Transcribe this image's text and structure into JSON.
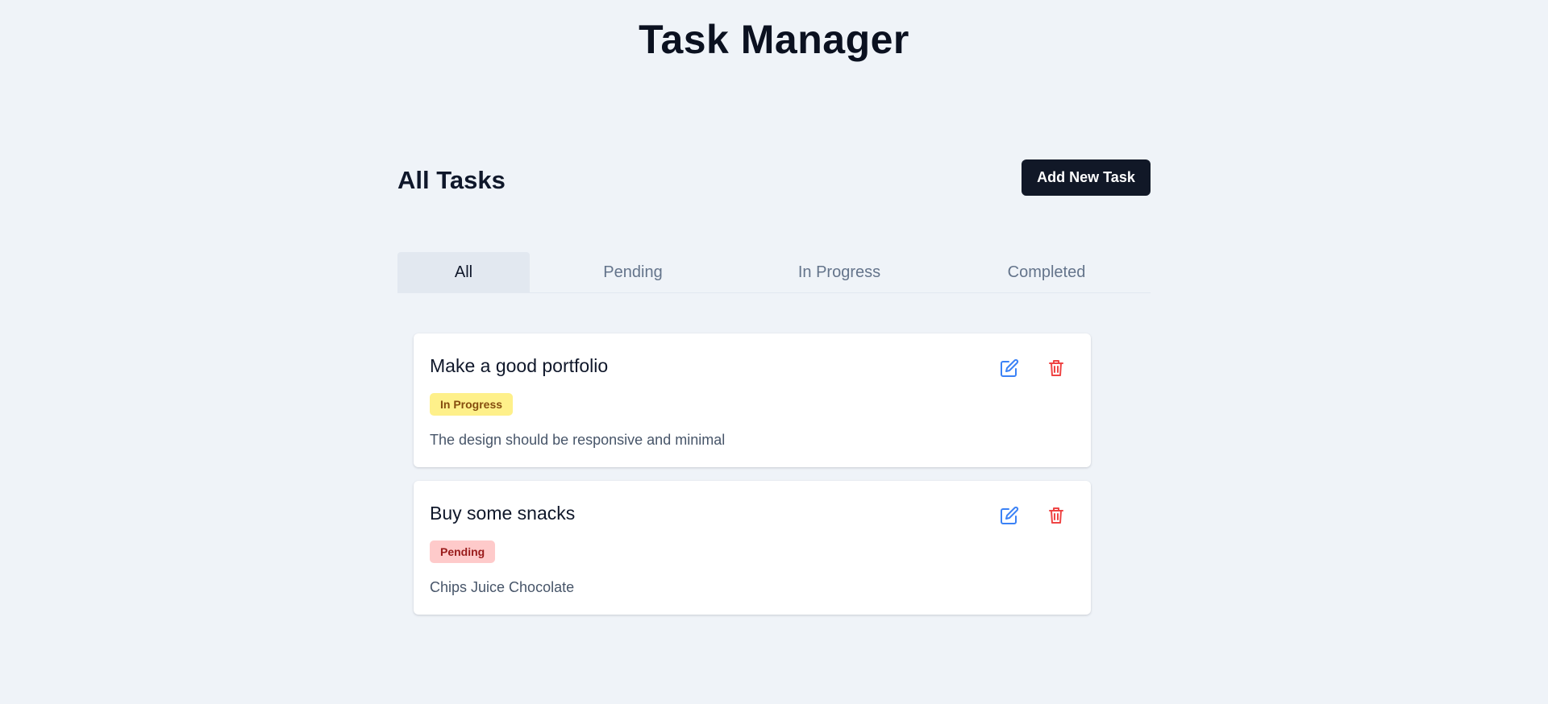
{
  "app": {
    "title": "Task Manager"
  },
  "section": {
    "title": "All Tasks",
    "add_button_label": "Add New Task"
  },
  "tabs": [
    {
      "label": "All",
      "active": true
    },
    {
      "label": "Pending",
      "active": false
    },
    {
      "label": "In Progress",
      "active": false
    },
    {
      "label": "Completed",
      "active": false
    }
  ],
  "tasks": [
    {
      "title": "Make a good portfolio",
      "status": "In Progress",
      "description": "The design should be responsive and minimal"
    },
    {
      "title": "Buy some snacks",
      "status": "Pending",
      "description": "Chips Juice Chocolate"
    }
  ],
  "icons": {
    "edit": "edit-icon",
    "delete": "trash-icon"
  },
  "colors": {
    "background": "#eff3f8",
    "primary_button": "#111827",
    "edit_icon": "#3b82f6",
    "delete_icon": "#ef4444",
    "badge_in_progress_bg": "#fef08a",
    "badge_in_progress_text": "#854d0e",
    "badge_pending_bg": "#fecaca",
    "badge_pending_text": "#991b1b",
    "active_tab_bg": "#e2e8f0"
  }
}
